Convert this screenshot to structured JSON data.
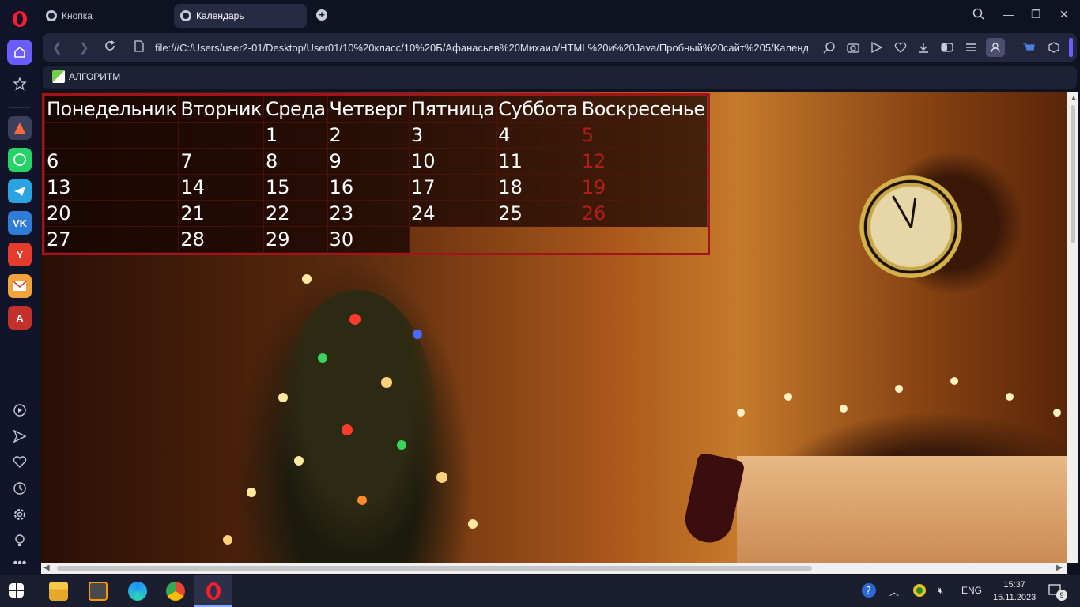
{
  "tabs": [
    {
      "label": "Кнопка"
    },
    {
      "label": "Календарь"
    }
  ],
  "address_bar": {
    "url": "file:///C:/Users/user2-01/Desktop/User01/10%20класс/10%20Б/Афанасьев%20Михаил/HTML%20и%20Java/Пробный%20сайт%205/Календа"
  },
  "bookmarks": [
    {
      "label": "АЛГОРИТМ"
    }
  ],
  "calendar": {
    "headers": [
      "Понедельник",
      "Вторник",
      "Среда",
      "Четверг",
      "Пятница",
      "Суббота",
      "Воскресенье"
    ],
    "rows": [
      [
        "",
        "",
        "1",
        "2",
        "3",
        "4",
        "5"
      ],
      [
        "6",
        "7",
        "8",
        "9",
        "10",
        "11",
        "12"
      ],
      [
        "13",
        "14",
        "15",
        "16",
        "17",
        "18",
        "19"
      ],
      [
        "20",
        "21",
        "22",
        "23",
        "24",
        "25",
        "26"
      ],
      [
        "27",
        "28",
        "29",
        "30",
        "",
        "",
        ""
      ]
    ],
    "sunday_color": "#b41c1c",
    "border_color": "#a0151c"
  },
  "taskbar": {
    "language": "ENG",
    "time": "15:37",
    "date": "15.11.2023",
    "notifications": "9"
  },
  "sidebar": {
    "accent": "#6b5cff"
  }
}
